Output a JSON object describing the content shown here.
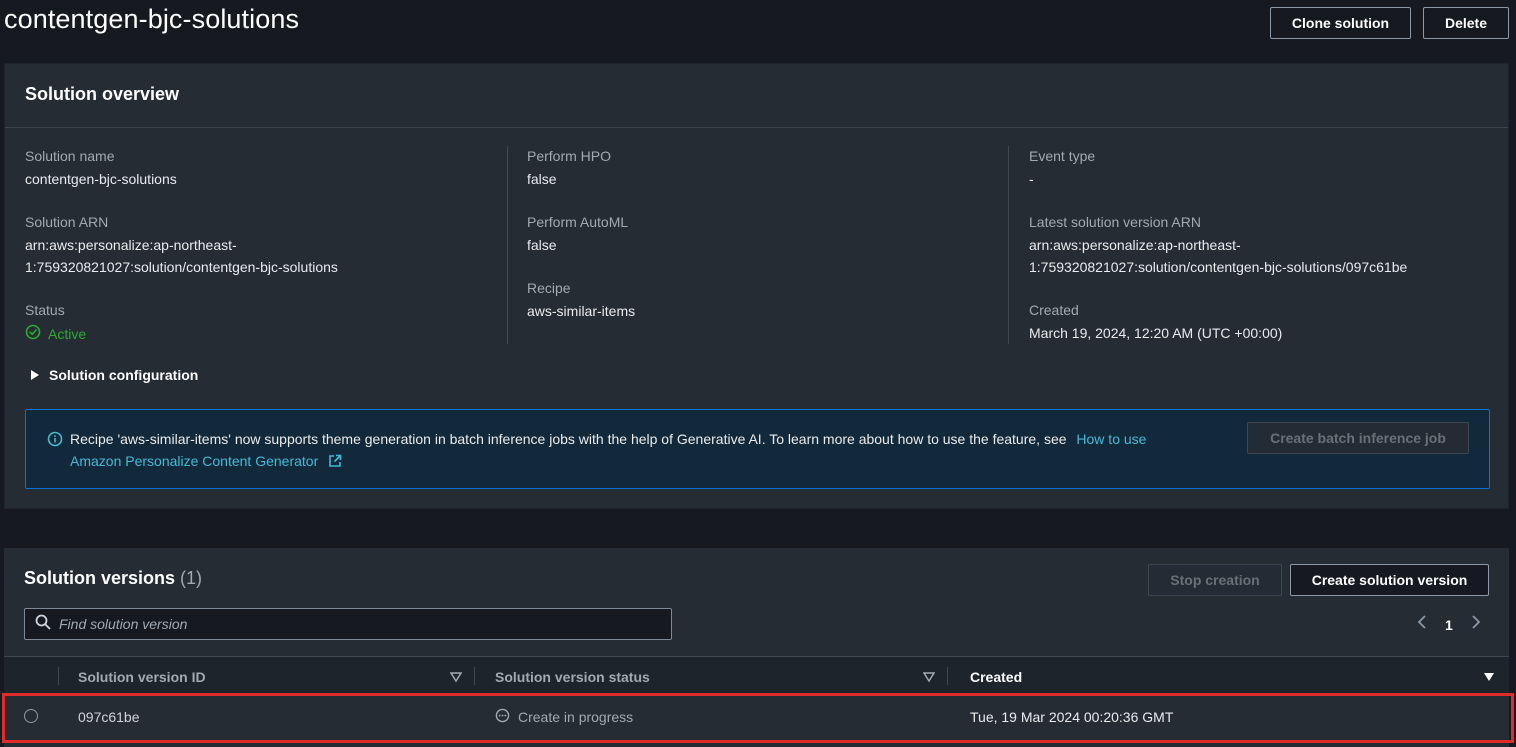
{
  "header": {
    "title": "contentgen-bjc-solutions",
    "clone_label": "Clone solution",
    "delete_label": "Delete"
  },
  "overview": {
    "title": "Solution overview",
    "solution_name_label": "Solution name",
    "solution_name": "contentgen-bjc-solutions",
    "solution_arn_label": "Solution ARN",
    "solution_arn_line1": "arn:aws:personalize:ap-northeast-",
    "solution_arn_line2": "1:759320821027:solution/contentgen-bjc-solutions",
    "status_label": "Status",
    "status": "Active",
    "perform_hpo_label": "Perform HPO",
    "perform_hpo": "false",
    "perform_automl_label": "Perform AutoML",
    "perform_automl": "false",
    "recipe_label": "Recipe",
    "recipe": "aws-similar-items",
    "event_type_label": "Event type",
    "event_type": "-",
    "latest_arn_label": "Latest solution version ARN",
    "latest_arn_line1": "arn:aws:personalize:ap-northeast-",
    "latest_arn_line2": "1:759320821027:solution/contentgen-bjc-solutions/097c61be",
    "created_label": "Created",
    "created": "March 19, 2024, 12:20 AM (UTC +00:00)",
    "config_toggle": "Solution configuration"
  },
  "alert": {
    "text": "Recipe 'aws-similar-items' now supports theme generation in batch inference jobs with the help of Generative AI. To learn more about how to use the feature, see",
    "link_part1": "How to use",
    "link_part2": "Amazon Personalize Content Generator",
    "button": "Create batch inference job"
  },
  "versions": {
    "title": "Solution versions",
    "count": "(1)",
    "stop_label": "Stop creation",
    "create_label": "Create solution version",
    "search_placeholder": "Find solution version",
    "page": "1",
    "columns": [
      "Solution version ID",
      "Solution version status",
      "Created"
    ],
    "rows": [
      {
        "id": "097c61be",
        "status": "Create in progress",
        "created": "Tue, 19 Mar 2024 00:20:36 GMT"
      }
    ]
  },
  "colors": {
    "background": "#16191f",
    "panel": "#252c34",
    "link": "#44b9d6",
    "success": "#29ad32",
    "info_border": "#0972d3",
    "highlight": "#e02b2b"
  }
}
